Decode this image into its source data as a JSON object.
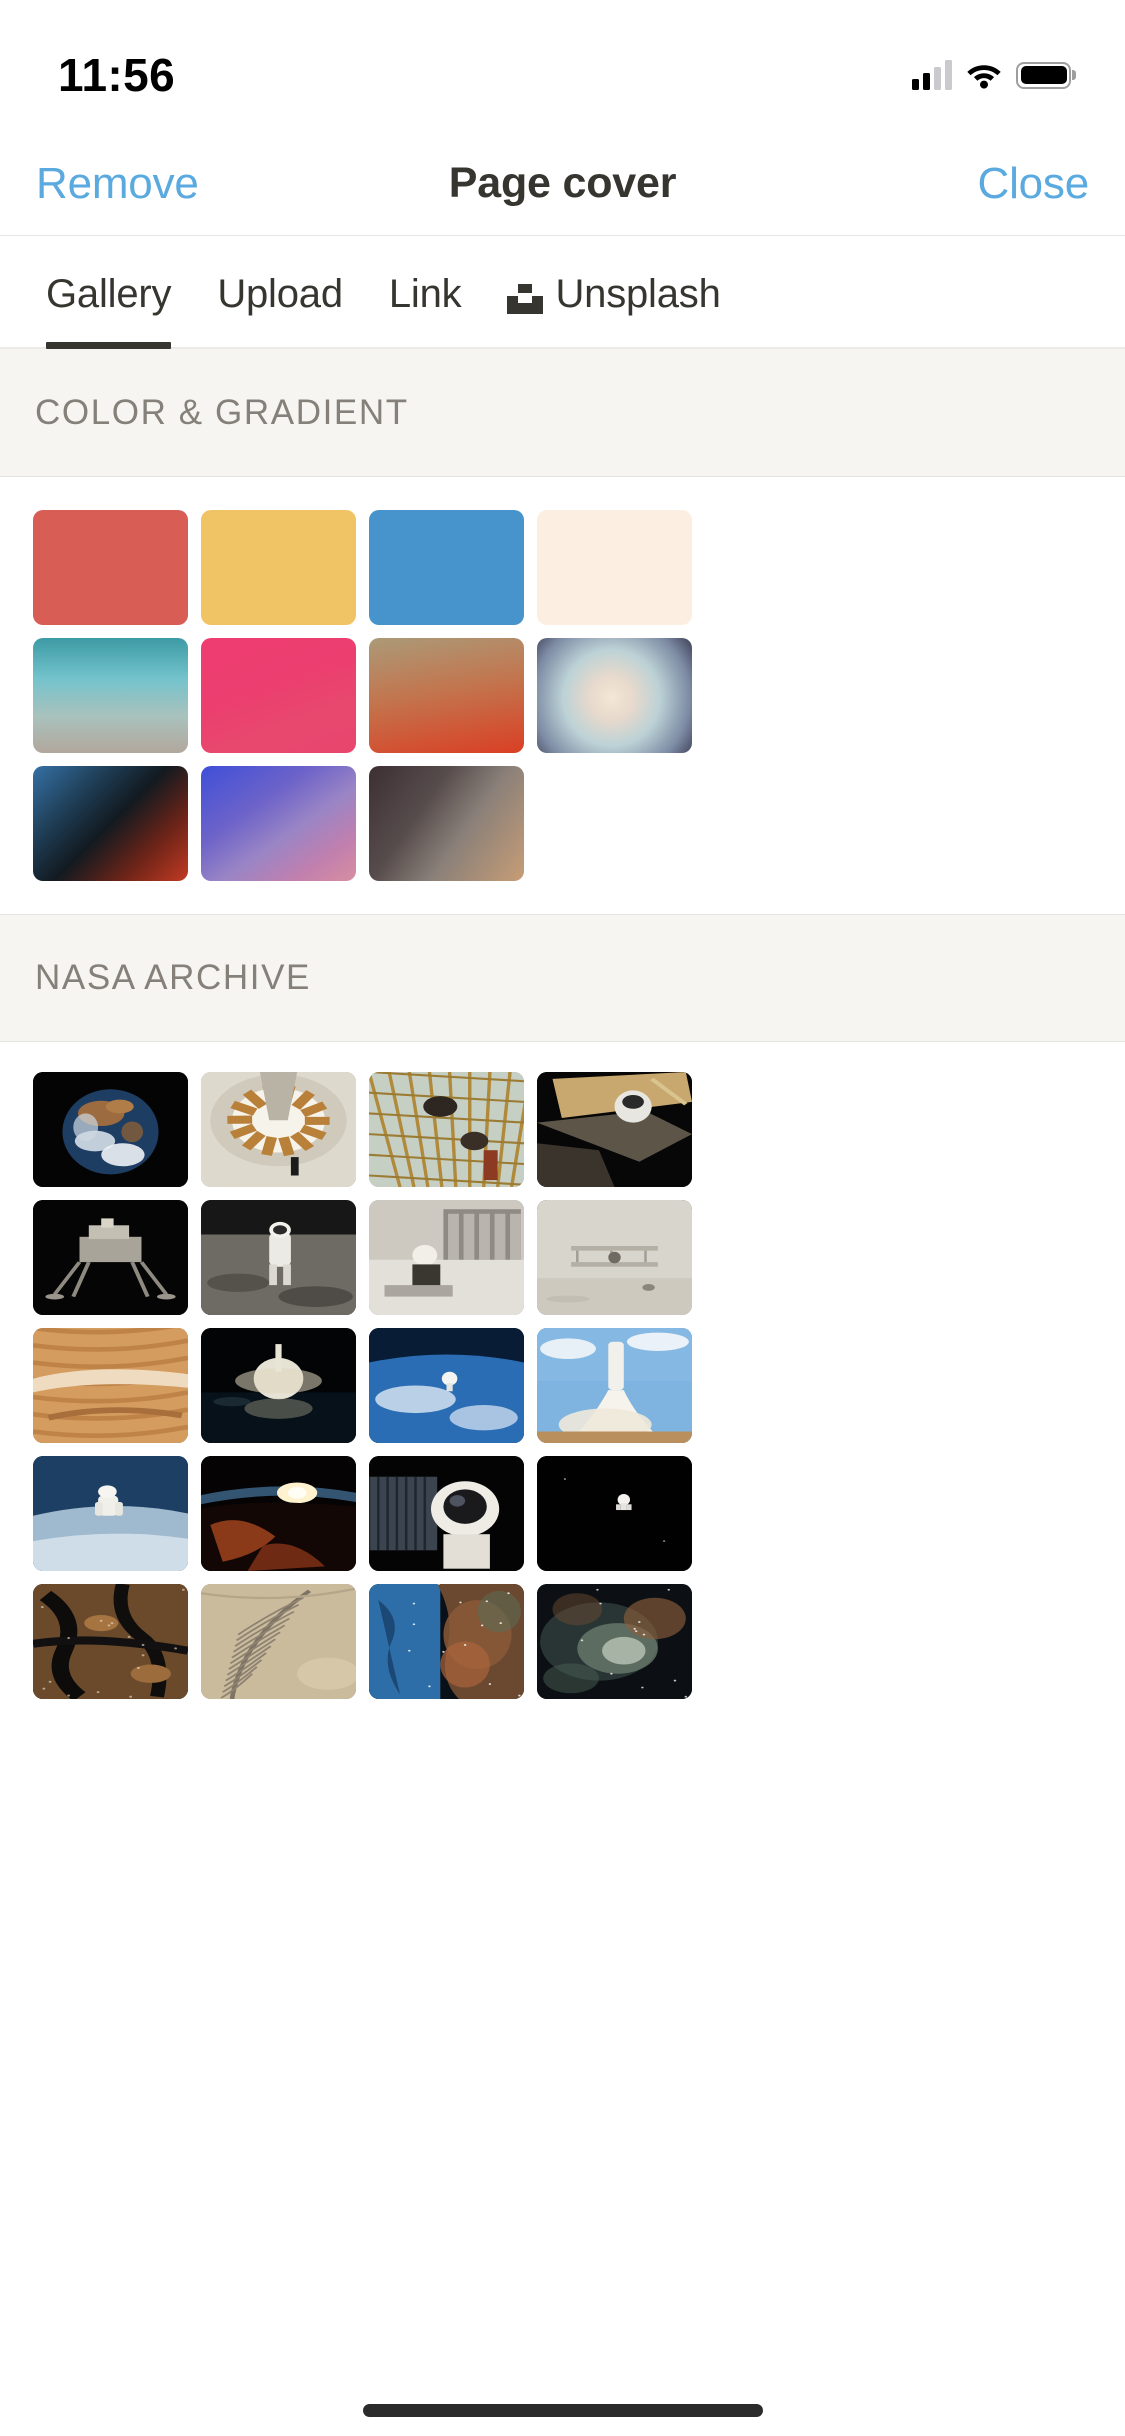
{
  "status_bar": {
    "time": "11:56",
    "signal_icon": "cellular-signal-icon",
    "wifi_icon": "wifi-icon",
    "battery_icon": "battery-icon"
  },
  "nav": {
    "remove_label": "Remove",
    "title": "Page cover",
    "close_label": "Close",
    "accent_color": "#5aaae0",
    "title_color": "#37352f"
  },
  "tabs": {
    "active": "Gallery",
    "items": [
      {
        "label": "Gallery",
        "icon": null,
        "active": true
      },
      {
        "label": "Upload",
        "icon": null,
        "active": false
      },
      {
        "label": "Link",
        "icon": null,
        "active": false
      },
      {
        "label": "Unsplash",
        "icon": "unsplash-logo-icon",
        "active": false
      }
    ]
  },
  "sections": [
    {
      "id": "color-gradient",
      "title": "COLOR & GRADIENT"
    },
    {
      "id": "nasa-archive",
      "title": "NASA ARCHIVE"
    }
  ],
  "color_gradient": {
    "title": "COLOR & GRADIENT",
    "swatches": [
      {
        "name": "red",
        "css": "#d75d55"
      },
      {
        "name": "yellow",
        "css": "#f0c464"
      },
      {
        "name": "blue",
        "css": "#4694cb"
      },
      {
        "name": "cream",
        "css": "#fdeee2"
      },
      {
        "name": "teal-fade",
        "css": "linear-gradient(180deg,#3c9aa4 0%,#73c3cc 35%,#a9c2bd 68%,#b2a79c 100%)"
      },
      {
        "name": "pink-magenta",
        "css": "linear-gradient(160deg,#ef3d72 0%,#ec3e6f 40%,#e8486e 70%,#e9456d 100%)"
      },
      {
        "name": "tan-to-red",
        "css": "linear-gradient(170deg,#ab9a78 0%,#c2764f 45%,#da3f24 100%)"
      },
      {
        "name": "soft-radial",
        "css": "radial-gradient(circle at 48% 52%, #f4e7d4 0%, #e7d9cc 22%, #bcd2d6 48%, #7d8ba4 78%, #3d3f56 100%)"
      },
      {
        "name": "blue-dark-red",
        "css": "linear-gradient(135deg,#3571a4 0%,#1e3b52 30%,#121a20 50%,#6d2418 75%,#c33a22 100%)"
      },
      {
        "name": "blue-purple-pink",
        "css": "linear-gradient(145deg,#3f4fd8 0%,#6d63c9 35%,#9a85c5 58%,#c17fae 80%,#d88fa0 100%)"
      },
      {
        "name": "dark-to-tan",
        "css": "linear-gradient(125deg,#3d2f33 0%,#574c4c 35%,#8a8079 60%,#c79d76 100%)"
      }
    ]
  },
  "nasa_archive": {
    "title": "NASA ARCHIVE",
    "photos": [
      {
        "name": "earth-from-space"
      },
      {
        "name": "wind-tunnel-interior"
      },
      {
        "name": "engineers-on-scaffolding"
      },
      {
        "name": "astronaut-spacewalk-structure"
      },
      {
        "name": "lunar-module"
      },
      {
        "name": "astronaut-on-moon"
      },
      {
        "name": "mission-control-computers"
      },
      {
        "name": "wright-flyer-biplane"
      },
      {
        "name": "mars-surface-terrain"
      },
      {
        "name": "night-launch-reflection"
      },
      {
        "name": "astronaut-over-earth"
      },
      {
        "name": "shuttle-launch-daytime"
      },
      {
        "name": "astronaut-untethered-eva"
      },
      {
        "name": "sunrise-over-earth-limb"
      },
      {
        "name": "astronaut-helmet-closeup"
      },
      {
        "name": "lone-astronaut-black-space"
      },
      {
        "name": "earth-river-delta-from-orbit"
      },
      {
        "name": "desert-mountain-from-orbit"
      },
      {
        "name": "carina-nebula"
      },
      {
        "name": "nebula-cloud"
      }
    ]
  },
  "home_indicator": {
    "name": "home-indicator"
  }
}
